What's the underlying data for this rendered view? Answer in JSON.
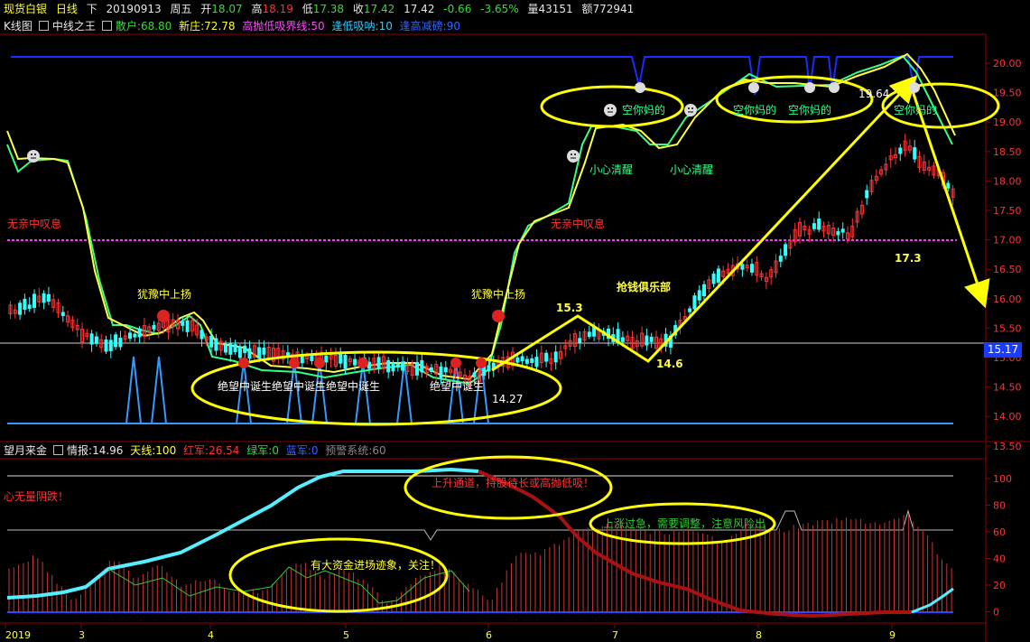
{
  "header": {
    "name": "现货白银",
    "period": "日线",
    "direction": "下",
    "date": "20190913",
    "weekday": "周五",
    "open_label": "开",
    "open": "18.07",
    "high_label": "高",
    "high": "18.19",
    "low_label": "低",
    "low": "17.38",
    "close_label": "收",
    "close": "17.42",
    "last": "17.42",
    "change": "-0.66",
    "change_pct": "-3.65%",
    "volume_label": "量",
    "volume": "43151",
    "amount_label": "额",
    "amount": "772941"
  },
  "main_indicator": {
    "chart_label": "K线图",
    "indicator_name": "中线之王",
    "sanhu_label": "散户:",
    "sanhu": "68.80",
    "xinzhuang_label": "新庄:",
    "xinzhuang": "72.78",
    "gaopao_label": "高抛低吸界线:",
    "gaopao": "50",
    "fengdi_label": "逢低吸呐:",
    "fengdi": "10",
    "fenggao_label": "逢高减磅:",
    "fenggao": "90"
  },
  "sub_indicator": {
    "name": "望月来金",
    "qingbao_label": "情报:",
    "qingbao": "14.96",
    "tianxian_label": "天线:",
    "tianxian": "100",
    "hongjun_label": "红军:",
    "hongjun": "26.54",
    "lvjun_label": "绿军:",
    "lvjun": "0",
    "lanjun_label": "蓝军:",
    "lanjun": "0",
    "yujing_label": "预警系统:",
    "yujing": "60"
  },
  "price_tag": "15.17",
  "annotations": {
    "wuqin_left": "无亲中叹息",
    "wuqin_mid": "无亲中叹息",
    "youyu_left": "犹豫中上扬",
    "youyu_mid": "犹豫中上扬",
    "juewang_left": "绝望中诞生绝望中诞生绝望中诞生",
    "juewang_right": "绝望中诞生",
    "xiaoxin1": "小心清醒",
    "xiaoxin2": "小心清醒",
    "kongni1": "空你妈的",
    "kongni2": "空你妈的",
    "kongni3": "空你妈的",
    "kongni4": "空你妈的",
    "qiangqian": "抢钱俱乐部",
    "p1427": "14.27",
    "p153": "15.3",
    "p146": "14.6",
    "p1964": "19.64",
    "p173": "17.3",
    "sub_shangsheng": "上升通道，持股待长或高抛低吸！",
    "sub_shangzhang": "上涨过急，需要调整，注意风险出",
    "sub_zijin": "有大资金进场迹象，关注！",
    "sub_xinwu": "心无量阴跌！"
  },
  "y_axis_main": [
    "20.00",
    "19.50",
    "19.00",
    "18.50",
    "18.00",
    "17.50",
    "17.00",
    "16.50",
    "16.00",
    "15.50",
    "15.00",
    "14.50",
    "14.00",
    "13.50"
  ],
  "y_axis_sub": [
    "100",
    "80",
    "60",
    "40",
    "20",
    "0"
  ],
  "x_axis": [
    "2019",
    "3",
    "4",
    "5",
    "6",
    "7",
    "8",
    "9"
  ],
  "colors": {
    "bg": "#000000",
    "up_candle": "#ff3333",
    "down_candle": "#33ffff",
    "ellipse": "#ffff00",
    "arrow": "#ffff00",
    "line_green": "#33ff88",
    "line_yellow": "#ffff44",
    "signal_blue": "#1a4dff",
    "signal_light": "#3399ff",
    "magenta": "#ff33ff"
  }
}
